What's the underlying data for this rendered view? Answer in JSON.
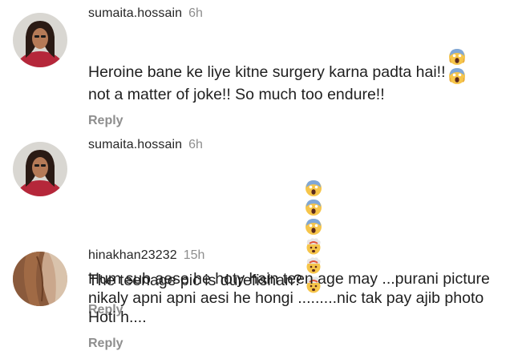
{
  "comments": [
    {
      "username": "sumaita.hossain",
      "time": "6h",
      "text_line1": "Heroine bane ke liye kitne surgery karna padta hai!!",
      "text_line2": "not a matter of joke!! So much too endure!!",
      "emojis": [
        "screaming-face-emoji",
        "screaming-face-emoji"
      ],
      "reply_label": "Reply"
    },
    {
      "username": "sumaita.hossain",
      "time": "6h",
      "text": "The teenage pic is durefishan?",
      "emojis": [
        "screaming-face-emoji",
        "screaming-face-emoji",
        "screaming-face-emoji",
        "exploding-head-emoji",
        "exploding-head-emoji",
        "exploding-head-emoji"
      ],
      "reply_label": "Reply"
    },
    {
      "username": "hinakhan23232",
      "time": "15h",
      "text": "Hum sub aese he hoty hain teen age may ...purani picture\nnikaly apni apni aesi he hongi .........nic tak pay ajib photo\nHoti h....",
      "reply_label": "Reply"
    }
  ]
}
